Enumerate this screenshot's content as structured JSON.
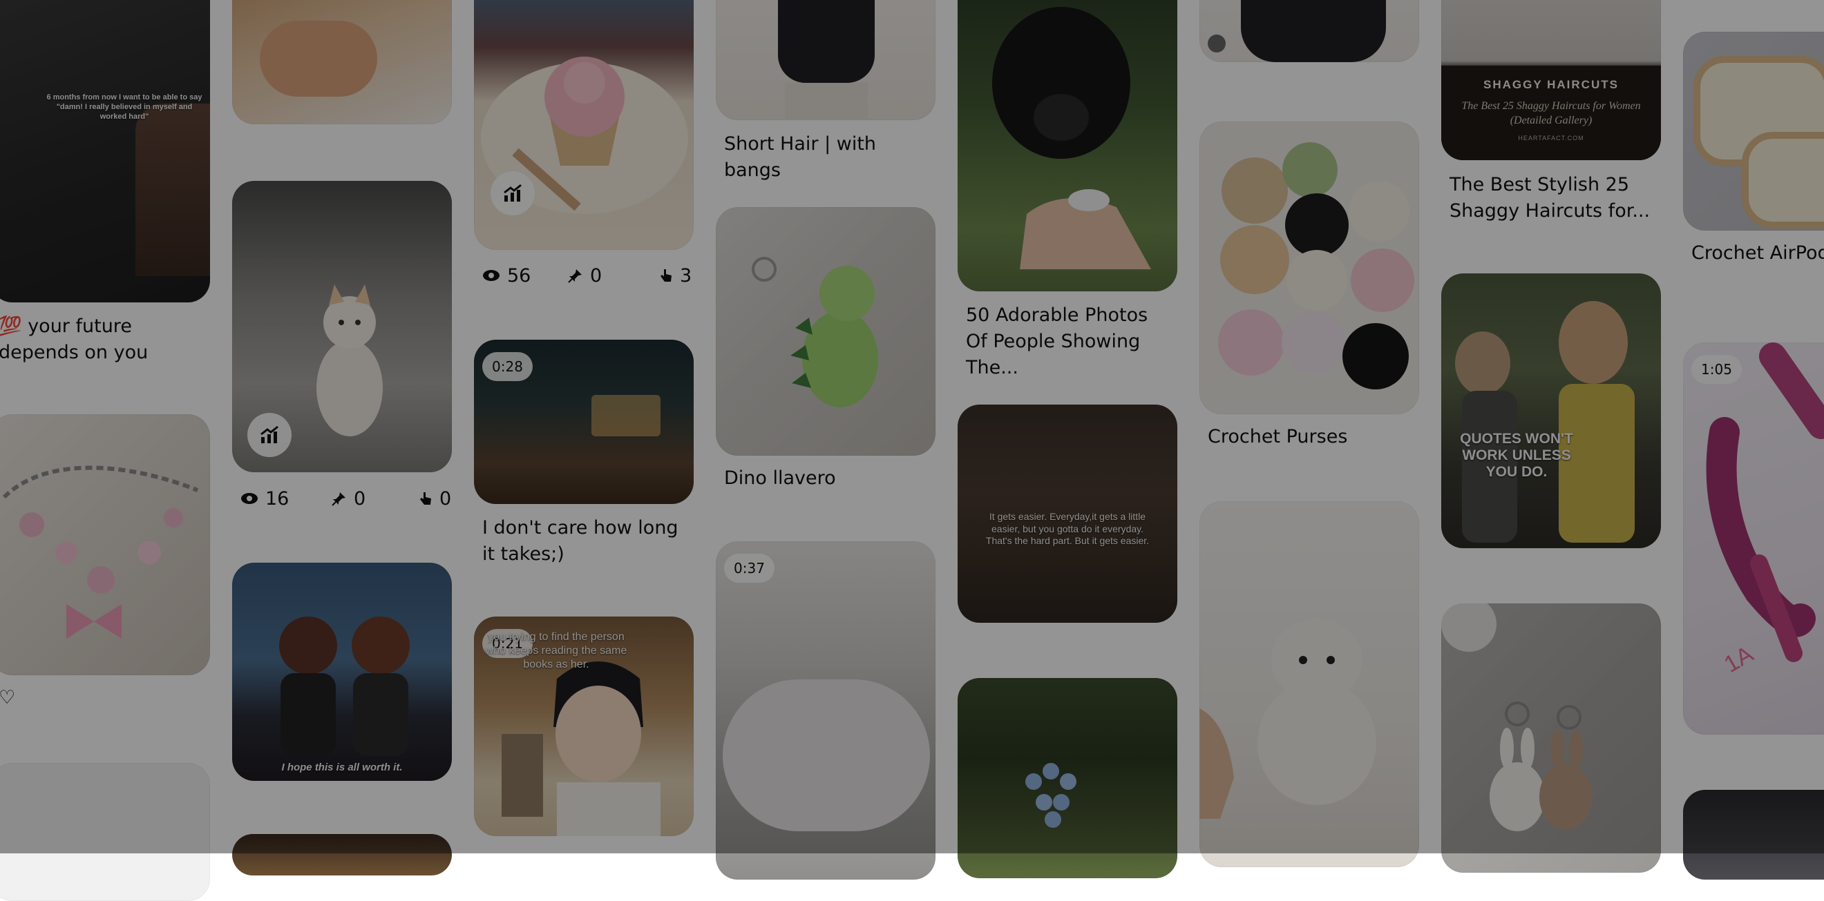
{
  "pins": {
    "future": {
      "title": "💯 your future depends on you",
      "image_text": "6 months from now I want to be able to say \"damn! I really believed in myself and worked hard\""
    },
    "bracelet": {
      "title": "♡"
    },
    "kitten": {
      "views": "16",
      "saves": "0",
      "clicks": "0"
    },
    "anime_girls": {
      "image_text": "I hope this is all worth it."
    },
    "cupcake": {
      "views": "56",
      "saves": "0",
      "clicks": "3"
    },
    "desk_study": {
      "duration": "0:28",
      "title": "I don't care how long it takes;)"
    },
    "anime_boy": {
      "duration": "0:21",
      "image_text": "you trying to find the person who keeps reading the same books as her."
    },
    "short_hair": {
      "title": "Short Hair | with bangs"
    },
    "dino": {
      "title": "Dino llavero"
    },
    "icing_video": {
      "duration": "0:37"
    },
    "puppy": {
      "title": "50 Adorable Photos Of People Showing The..."
    },
    "gets_easier": {
      "image_text": "It gets easier. Everyday,it gets a little easier, but you gotta do it everyday. That's the hard part. But it gets easier."
    },
    "crochet_purses": {
      "title": "Crochet Purses"
    },
    "shaggy": {
      "title": "The Best Stylish 25 Shaggy Haircuts for...",
      "banner_heading": "SHAGGY HAIRCUTS",
      "banner_sub": "The Best 25 Shaggy Haircuts for Women (Detailed Gallery)",
      "banner_site": "HEARTAFACT.COM"
    },
    "quotes": {
      "image_text": "QUOTES WON'T WORK UNLESS YOU DO."
    },
    "airpod": {
      "title": "Crochet AirPod case"
    },
    "cake_piping": {
      "duration": "1:05",
      "cake_text": "1A"
    }
  },
  "colors": {
    "background": "#ffffff",
    "overlay": "rgba(0,0,0,0.42)",
    "title_text": "#111111"
  },
  "icons": {
    "stats": "trend-up-icon",
    "views": "eye-icon",
    "saves": "pin-icon",
    "clicks": "pointer-hand-icon",
    "lens": "visual-search-icon"
  }
}
